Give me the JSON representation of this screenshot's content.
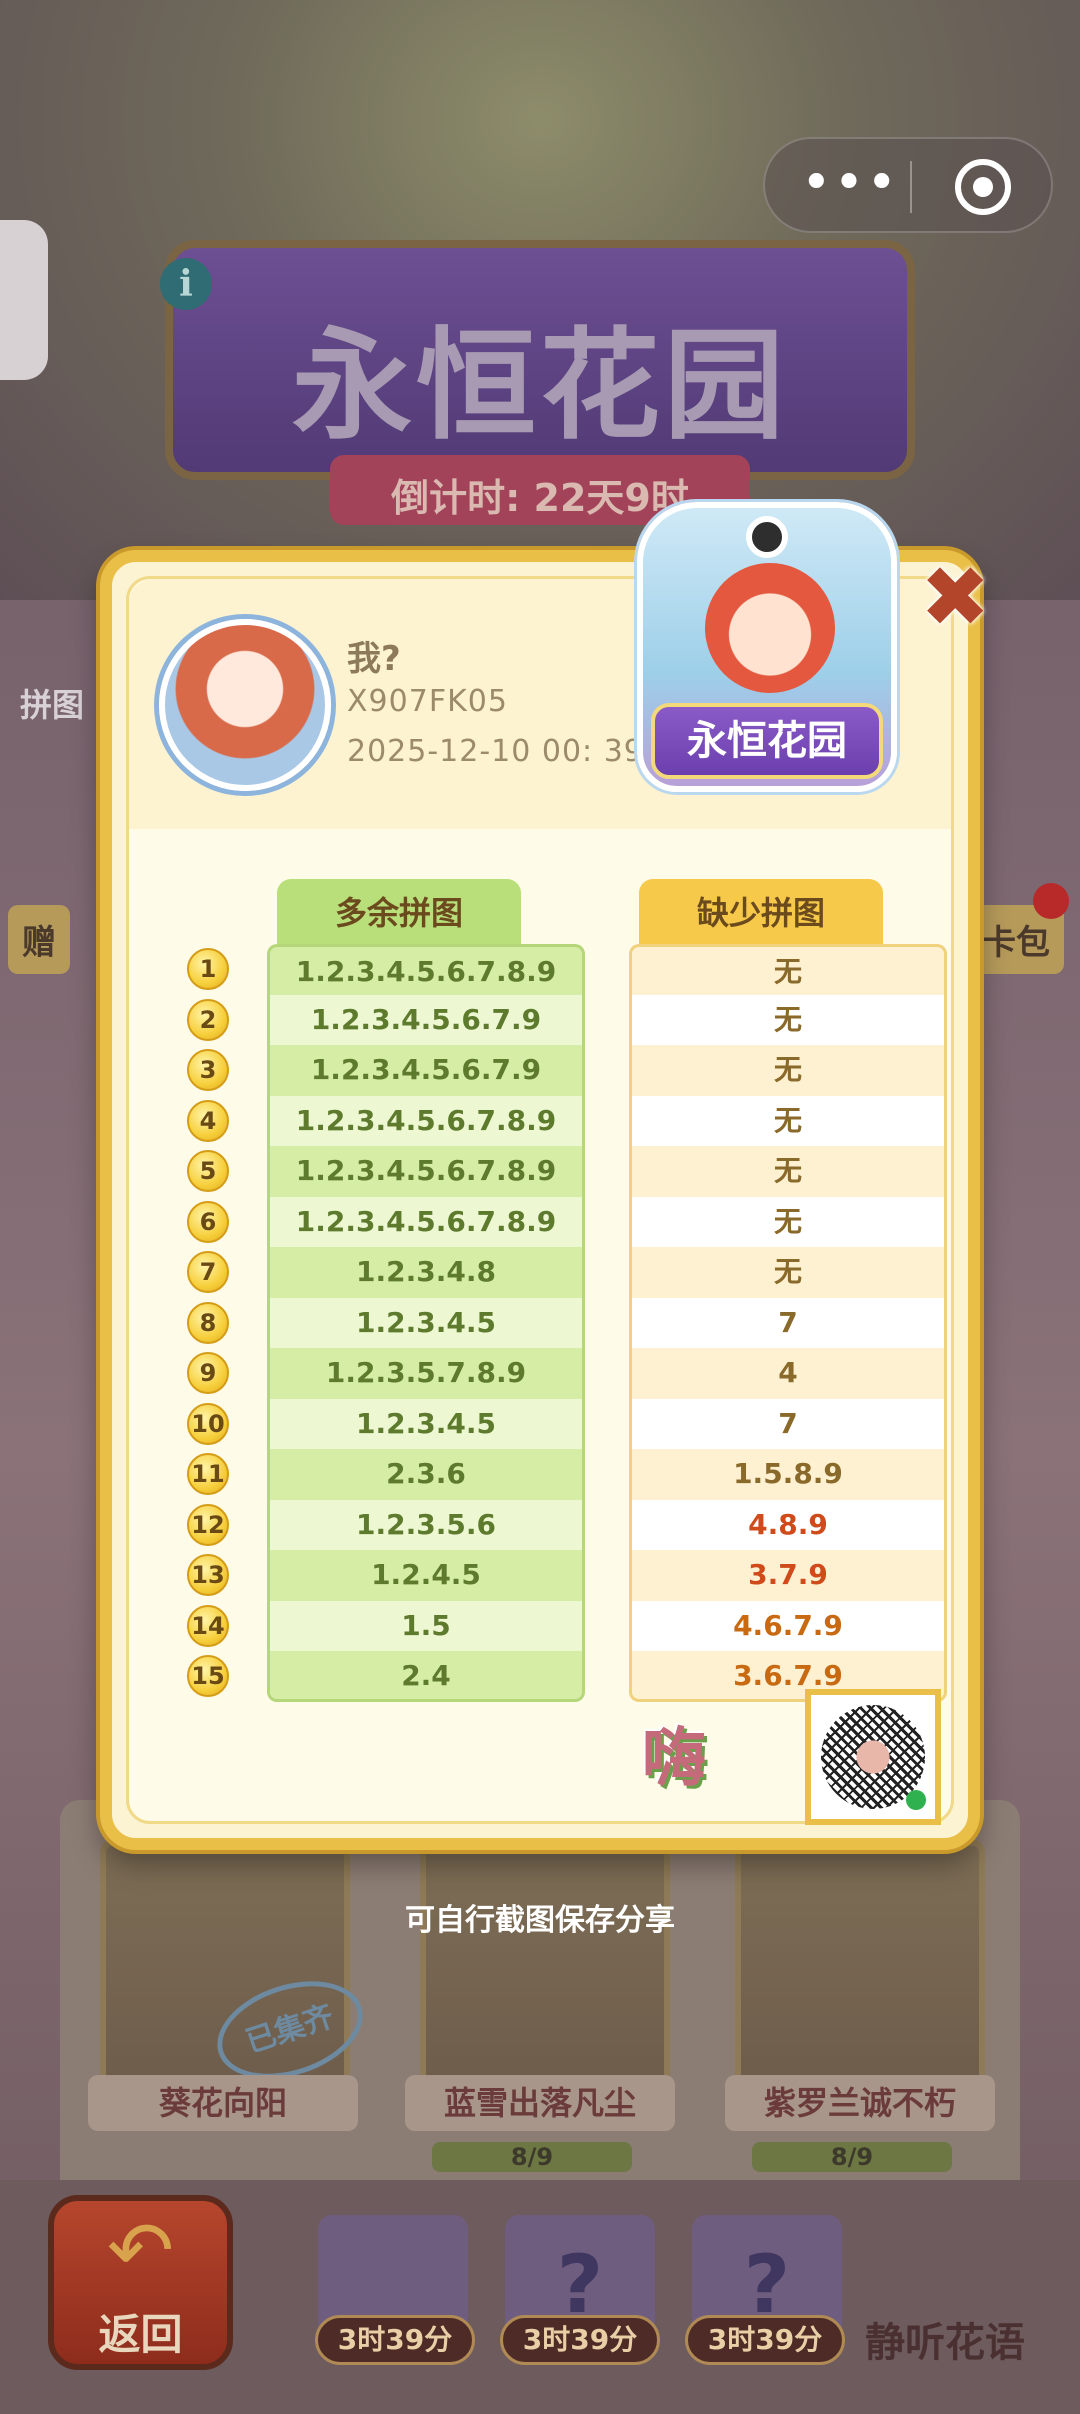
{
  "background": {
    "event_title": "永恒花园",
    "countdown": "倒计时: 22天9时",
    "side_left_label": "赠",
    "side_right_label": "卡包",
    "pintu_label": "拼图",
    "cards": [
      {
        "label": "葵花向阳",
        "progress": ""
      },
      {
        "label": "蓝雪出落凡尘",
        "progress": "8/9"
      },
      {
        "label": "紫罗兰诚不朽",
        "progress": "8/9"
      }
    ],
    "stamp": "已集齐",
    "back_label": "返回",
    "timers": [
      "3时39分",
      "3时39分",
      "3时39分"
    ],
    "listen_label": "静听花语"
  },
  "capsule": {
    "more_icon": "more-dots-icon",
    "close_icon": "target-circle-icon"
  },
  "user": {
    "name": "我?",
    "id": "X907FK05",
    "time": "2025-12-10 00: 39"
  },
  "badge": {
    "title": "永恒花园"
  },
  "table": {
    "extra_header": "多余拼图",
    "missing_header": "缺少拼图",
    "rows": [
      {
        "num": "1",
        "extra": "1.2.3.4.5.6.7.8.9",
        "missing": "无"
      },
      {
        "num": "2",
        "extra": "1.2.3.4.5.6.7.9",
        "missing": "无"
      },
      {
        "num": "3",
        "extra": "1.2.3.4.5.6.7.9",
        "missing": "无"
      },
      {
        "num": "4",
        "extra": "1.2.3.4.5.6.7.8.9",
        "missing": "无"
      },
      {
        "num": "5",
        "extra": "1.2.3.4.5.6.7.8.9",
        "missing": "无"
      },
      {
        "num": "6",
        "extra": "1.2.3.4.5.6.7.8.9",
        "missing": "无"
      },
      {
        "num": "7",
        "extra": "1.2.3.4.8",
        "missing": "无"
      },
      {
        "num": "8",
        "extra": "1.2.3.4.5",
        "missing": "7"
      },
      {
        "num": "9",
        "extra": "1.2.3.5.7.8.9",
        "missing": "4"
      },
      {
        "num": "10",
        "extra": "1.2.3.4.5",
        "missing": "7"
      },
      {
        "num": "11",
        "extra": "2.3.6",
        "missing": "1.5.8.9"
      },
      {
        "num": "12",
        "extra": "1.2.3.5.6",
        "missing": "4.8.9"
      },
      {
        "num": "13",
        "extra": "1.2.4.5",
        "missing": "3.7.9"
      },
      {
        "num": "14",
        "extra": "1.5",
        "missing": "4.6.7.9"
      },
      {
        "num": "15",
        "extra": "2.4",
        "missing": "3.6.7.9"
      }
    ]
  },
  "logo_text": "嗨",
  "share_hint": "可自行截图保存分享",
  "colors": {
    "gold": "#e9bf48",
    "green": "#b9df7a",
    "yellow": "#f7c94a",
    "red": "#d04a1a"
  }
}
